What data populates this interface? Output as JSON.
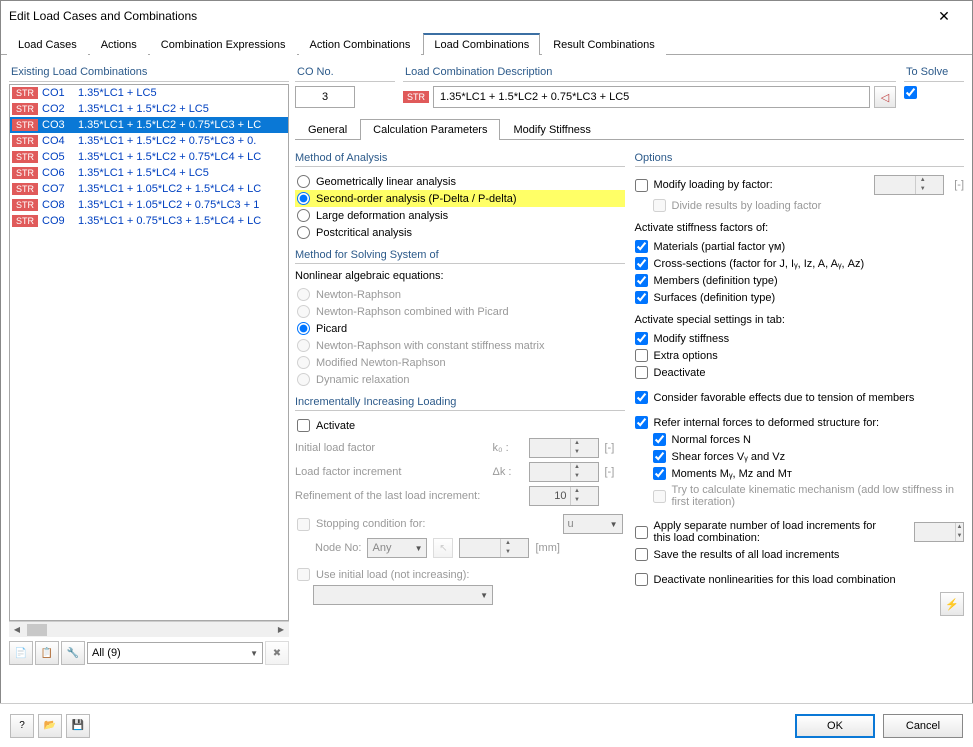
{
  "window": {
    "title": "Edit Load Cases and Combinations"
  },
  "mainTabs": [
    "Load Cases",
    "Actions",
    "Combination Expressions",
    "Action Combinations",
    "Load Combinations",
    "Result Combinations"
  ],
  "activeMainTab": 4,
  "leftPanel": {
    "title": "Existing Load Combinations",
    "badge": "STR",
    "rows": [
      {
        "id": "CO1",
        "desc": "1.35*LC1 + LC5"
      },
      {
        "id": "CO2",
        "desc": "1.35*LC1 + 1.5*LC2 + LC5"
      },
      {
        "id": "CO3",
        "desc": "1.35*LC1 + 1.5*LC2 + 0.75*LC3 + LC",
        "selected": true
      },
      {
        "id": "CO4",
        "desc": "1.35*LC1 + 1.5*LC2 + 0.75*LC3 + 0."
      },
      {
        "id": "CO5",
        "desc": "1.35*LC1 + 1.5*LC2 + 0.75*LC4 + LC"
      },
      {
        "id": "CO6",
        "desc": "1.35*LC1 + 1.5*LC4 + LC5"
      },
      {
        "id": "CO7",
        "desc": "1.35*LC1 + 1.05*LC2 + 1.5*LC4 + LC"
      },
      {
        "id": "CO8",
        "desc": "1.35*LC1 + 1.05*LC2 + 0.75*LC3 + 1"
      },
      {
        "id": "CO9",
        "desc": "1.35*LC1 + 0.75*LC3 + 1.5*LC4 + LC"
      }
    ],
    "filter": "All (9)"
  },
  "coNo": {
    "label": "CO No.",
    "value": "3"
  },
  "coDesc": {
    "label": "Load Combination Description",
    "badge": "STR",
    "value": "1.35*LC1 + 1.5*LC2 + 0.75*LC3 + LC5"
  },
  "toSolve": {
    "label": "To Solve",
    "checked": true
  },
  "subTabs": [
    "General",
    "Calculation Parameters",
    "Modify Stiffness"
  ],
  "activeSubTab": 1,
  "method": {
    "title": "Method of Analysis",
    "options": [
      {
        "label": "Geometrically linear analysis"
      },
      {
        "label": "Second-order analysis (P-Delta / P-delta)",
        "checked": true,
        "highlight": true
      },
      {
        "label": "Large deformation analysis"
      },
      {
        "label": "Postcritical analysis"
      }
    ]
  },
  "solving": {
    "title": "Method for Solving System of",
    "subtitle": "Nonlinear algebraic equations:",
    "options": [
      {
        "label": "Newton-Raphson",
        "disabled": true
      },
      {
        "label": "Newton-Raphson combined with Picard",
        "disabled": true
      },
      {
        "label": "Picard",
        "checked": true
      },
      {
        "label": "Newton-Raphson with constant stiffness matrix",
        "disabled": true
      },
      {
        "label": "Modified Newton-Raphson",
        "disabled": true
      },
      {
        "label": "Dynamic relaxation",
        "disabled": true
      }
    ]
  },
  "incr": {
    "title": "Incrementally Increasing Loading",
    "activate": "Activate",
    "rows": {
      "r1": {
        "label": "Initial load factor",
        "sym": "k₀ :",
        "unit": "[-]"
      },
      "r2": {
        "label": "Load factor increment",
        "sym": "Δk :",
        "unit": "[-]"
      },
      "r3": {
        "label": "Refinement of the last load increment:",
        "val": "10"
      },
      "r4": {
        "label": "Stopping condition for:",
        "sel": "u"
      },
      "r5": {
        "label": "Node No:",
        "sel": "Any",
        "unit": "[mm]"
      },
      "r6": {
        "label": "Use initial load (not increasing):"
      }
    }
  },
  "options": {
    "title": "Options",
    "modifyLoading": "Modify loading by factor:",
    "modifyUnit": "[-]",
    "divide": "Divide results by loading factor",
    "activateHdr": "Activate stiffness factors of:",
    "stiff": [
      {
        "label": "Materials (partial factor γᴍ)",
        "checked": true
      },
      {
        "label": "Cross-sections (factor for J, Iᵧ, Iᴢ, A, Aᵧ, Aᴢ)",
        "checked": true
      },
      {
        "label": "Members (definition type)",
        "checked": true
      },
      {
        "label": "Surfaces (definition type)",
        "checked": true
      }
    ],
    "specialHdr": "Activate special settings in tab:",
    "special": [
      {
        "label": "Modify stiffness",
        "checked": true
      },
      {
        "label": "Extra options",
        "checked": false
      },
      {
        "label": "Deactivate",
        "checked": false
      }
    ],
    "consider": {
      "label": "Consider favorable effects due to tension of members",
      "checked": true
    },
    "refer": {
      "label": "Refer internal forces to deformed structure for:",
      "checked": true
    },
    "referSub": [
      {
        "label": "Normal forces N",
        "checked": true
      },
      {
        "label": "Shear forces Vᵧ and Vᴢ",
        "checked": true
      },
      {
        "label": "Moments Mᵧ, Mᴢ and Mᴛ",
        "checked": true
      }
    ],
    "kinematic": "Try to calculate kinematic mechanism (add low stiffness in first iteration)",
    "separate": "Apply separate number of load increments for this load combination:",
    "saveResults": "Save the results of all load increments",
    "deactNonlin": "Deactivate nonlinearities for this load combination"
  },
  "footer": {
    "ok": "OK",
    "cancel": "Cancel"
  }
}
